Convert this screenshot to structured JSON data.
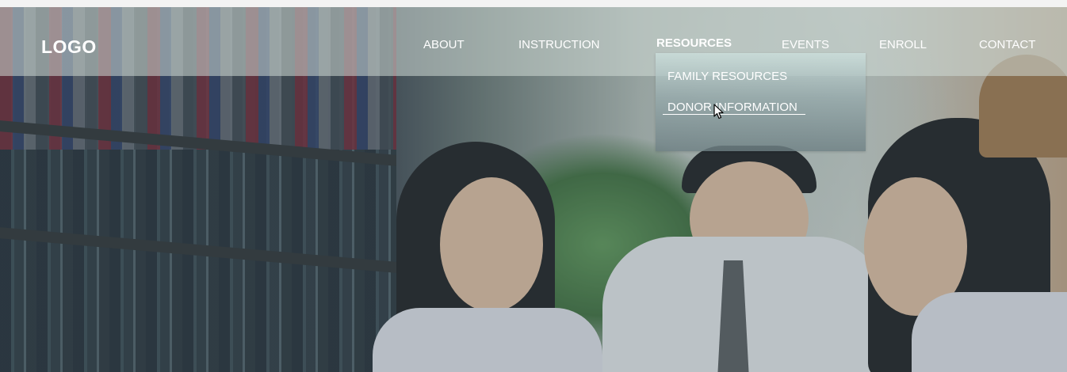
{
  "header": {
    "logo": "LOGO"
  },
  "nav": {
    "items": [
      {
        "label": "ABOUT"
      },
      {
        "label": "INSTRUCTION"
      },
      {
        "label": "RESOURCES"
      },
      {
        "label": "EVENTS"
      },
      {
        "label": "ENROLL"
      },
      {
        "label": "CONTACT"
      }
    ],
    "active": "RESOURCES"
  },
  "dropdown": {
    "items": [
      {
        "label": "FAMILY RESOURCES"
      },
      {
        "label": "DONOR INFORMATION"
      }
    ],
    "hovered": "DONOR INFORMATION"
  },
  "icons": {
    "cursor": "mouse-pointer-icon"
  },
  "colors": {
    "nav_text": "#ffffff",
    "header_bg": "#d0dad6"
  }
}
